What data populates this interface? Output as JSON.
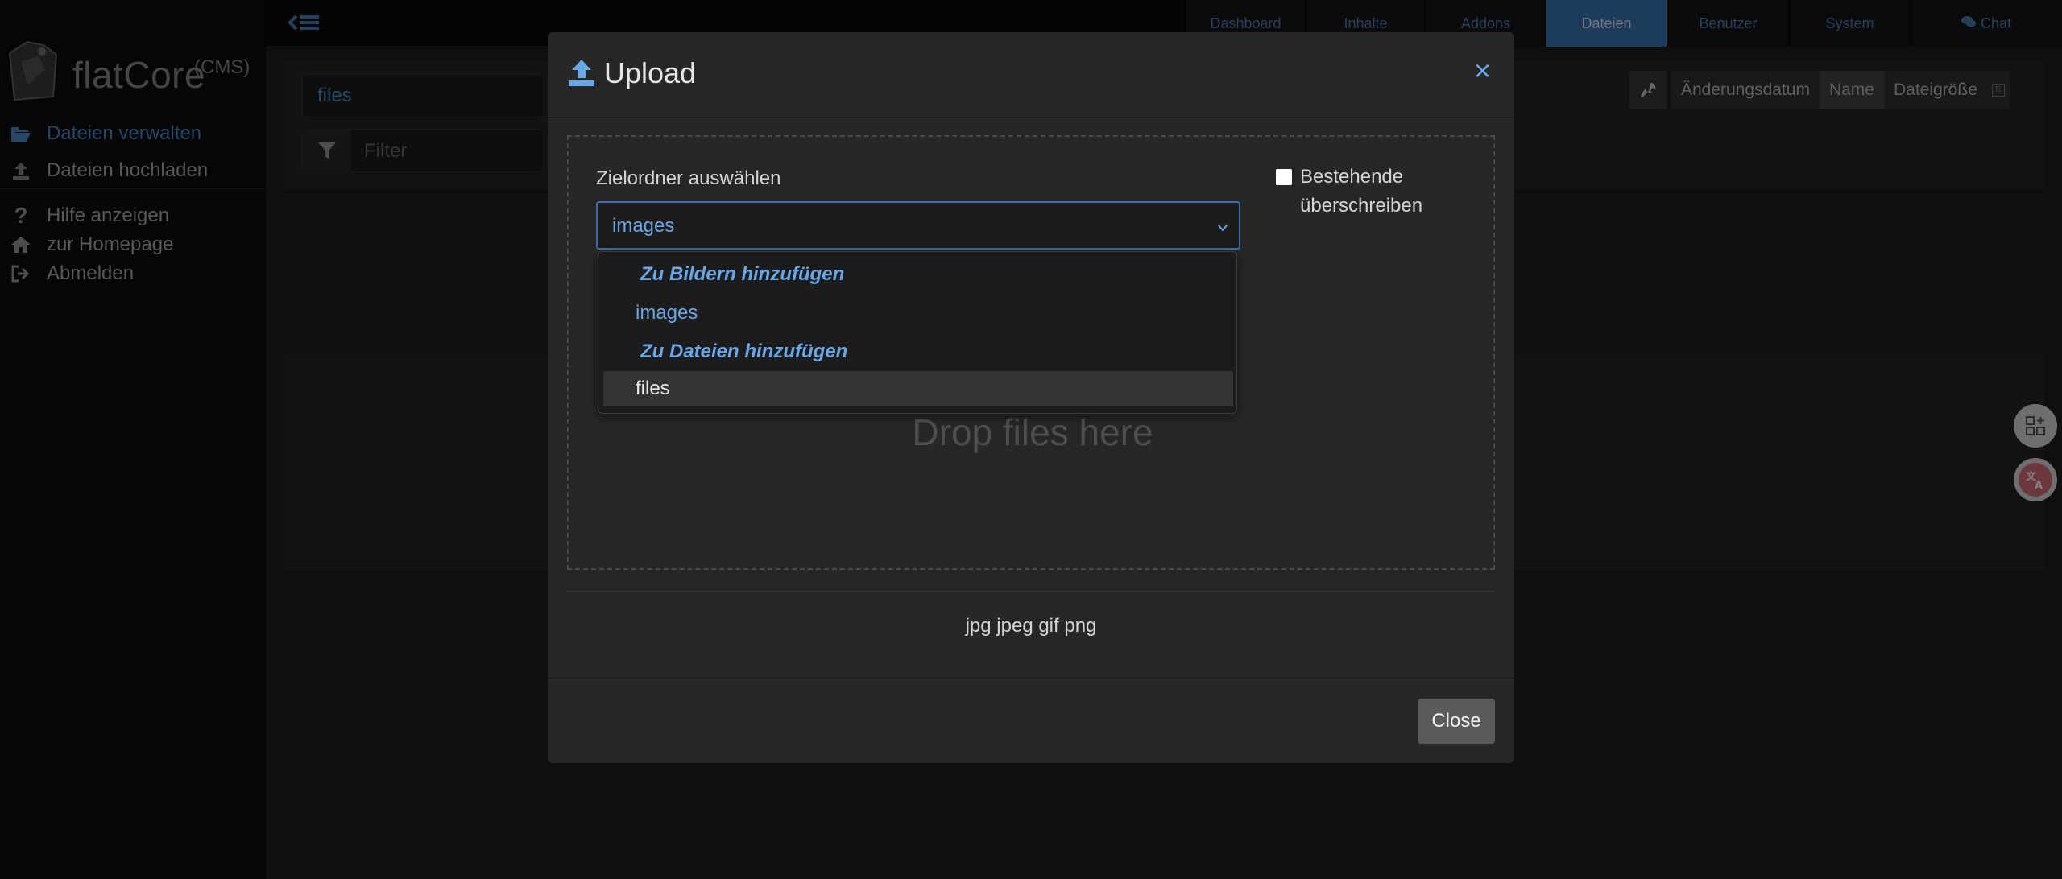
{
  "app": {
    "logo_text": "flatCore",
    "logo_sup": "(CMS)"
  },
  "sidebar": {
    "items": [
      {
        "label": "Dateien verwalten",
        "icon": "folder-open-icon",
        "active": true
      },
      {
        "label": "Dateien hochladen",
        "icon": "upload-icon",
        "active": false
      },
      {
        "label": "Hilfe anzeigen",
        "icon": "question-icon",
        "active": false
      },
      {
        "label": "zur Homepage",
        "icon": "home-icon",
        "active": false
      },
      {
        "label": "Abmelden",
        "icon": "sign-out-icon",
        "active": false
      }
    ]
  },
  "topnav": {
    "items": [
      {
        "label": "Dashboard"
      },
      {
        "label": "Inhalte"
      },
      {
        "label": "Addons"
      },
      {
        "label": "Dateien",
        "active": true
      },
      {
        "label": "Benutzer"
      },
      {
        "label": "System"
      },
      {
        "label": "Chat",
        "icon": "comments-icon"
      }
    ]
  },
  "filebrowser": {
    "path_value": "files",
    "filter_placeholder": "Filter",
    "sort": {
      "date": "Änderungsdatum",
      "name": "Name",
      "size": "Dateigröße",
      "mini": "R"
    }
  },
  "modal": {
    "title": "Upload",
    "close_x": "×",
    "drop_label": "Drop files here",
    "folder_label": "Zielordner auswählen",
    "folder_selected": "images",
    "overwrite_label": "Bestehende überschreiben",
    "dropdown": [
      {
        "type": "group",
        "label": "Zu Bildern hinzufügen"
      },
      {
        "type": "option",
        "label": "images"
      },
      {
        "type": "group",
        "label": "Zu Dateien hinzufügen"
      },
      {
        "type": "option",
        "label": "files",
        "highlighted": true
      }
    ],
    "allowed_types": "jpg jpeg gif png",
    "close_button": "Close"
  },
  "colors": {
    "accent": "#3a77b8",
    "link": "#6aa6e6",
    "sidebar_bg": "#0d0d0d",
    "modal_bg": "#272727"
  }
}
